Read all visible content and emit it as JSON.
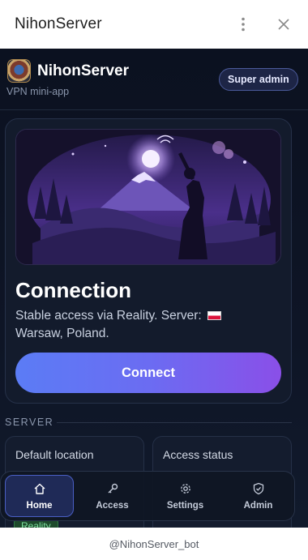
{
  "window": {
    "title": "NihonServer",
    "icons": [
      "kebab-menu-icon",
      "close-icon"
    ]
  },
  "app": {
    "name": "NihonServer",
    "subtitle": "VPN mini-app",
    "role_badge": "Super admin",
    "logo_icon": "nihon-logo-icon"
  },
  "connection": {
    "title": "Connection",
    "description_prefix": "Stable access via Reality. Server:",
    "flag_icon": "poland-flag-icon",
    "location": "Warsaw, Poland.",
    "connect_label": "Connect"
  },
  "server_section": {
    "label": "SERVER",
    "cards": [
      {
        "title": "Default location",
        "pill": "Reality"
      },
      {
        "title": "Access status"
      }
    ]
  },
  "nav": {
    "items": [
      {
        "label": "Home",
        "icon": "home-icon",
        "active": true
      },
      {
        "label": "Access",
        "icon": "key-icon",
        "active": false
      },
      {
        "label": "Settings",
        "icon": "gear-icon",
        "active": false
      },
      {
        "label": "Admin",
        "icon": "shield-check-icon",
        "active": false
      }
    ]
  },
  "footer": {
    "bot": "@NihonServer_bot"
  },
  "colors": {
    "background": "#0b1120",
    "accent_start": "#5b7cf5",
    "accent_end": "#8a4fe8",
    "nav_active": "#1f2a57"
  }
}
